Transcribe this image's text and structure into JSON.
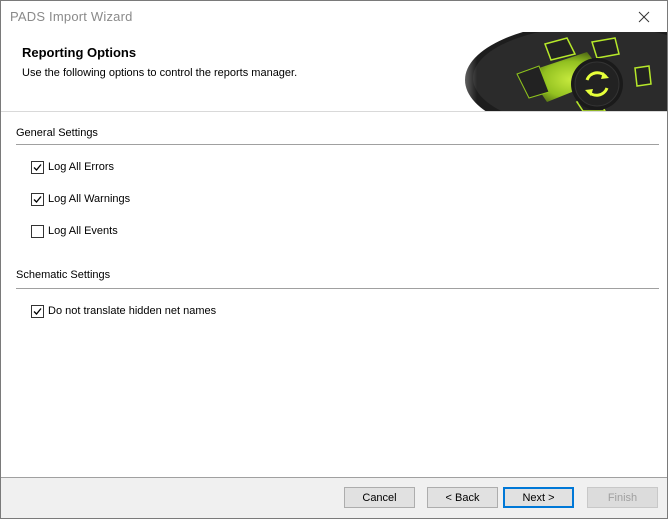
{
  "window": {
    "title": "PADS Import Wizard"
  },
  "header": {
    "title": "Reporting Options",
    "subtitle": "Use the following options to control the reports manager."
  },
  "general": {
    "label": "General Settings",
    "items": [
      {
        "label": "Log All Errors",
        "checked": true
      },
      {
        "label": "Log All Warnings",
        "checked": true
      },
      {
        "label": "Log All Events",
        "checked": false
      }
    ]
  },
  "schematic": {
    "label": "Schematic Settings",
    "items": [
      {
        "label": "Do not translate hidden net names",
        "checked": true
      }
    ]
  },
  "buttons": {
    "cancel": "Cancel",
    "back": "< Back",
    "next": "Next >",
    "finish": "Finish"
  },
  "icons": {
    "close": "close-icon",
    "check": "check-icon",
    "refresh": "refresh-icon",
    "graphic": "gear-wheel-graphic"
  },
  "colors": {
    "accent_green": "#b6e82a",
    "focus_blue": "#0078d7",
    "footer_bg": "#f0f0f0"
  }
}
